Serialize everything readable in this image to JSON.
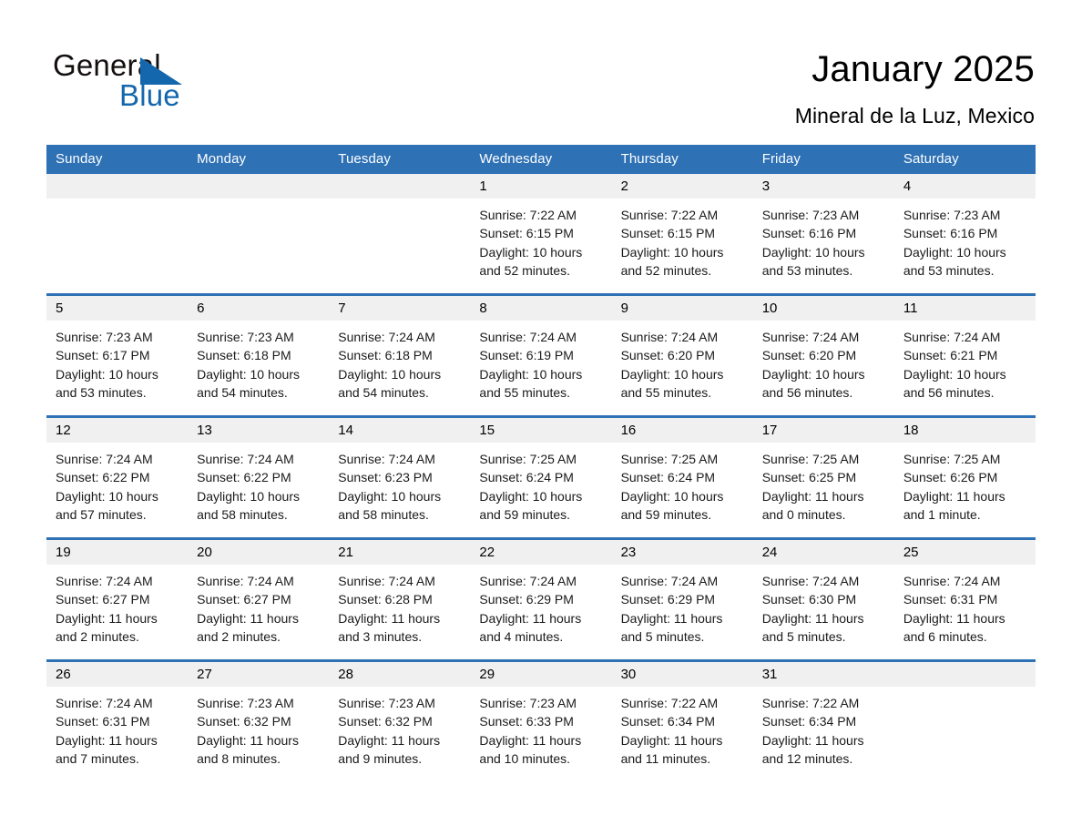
{
  "brand": {
    "word1": "General",
    "word2": "Blue",
    "triangle_color": "#1567ad"
  },
  "header": {
    "title": "January 2025",
    "subtitle": "Mineral de la Luz, Mexico"
  },
  "theme": {
    "header_blue": "#2e71b5",
    "daynum_band": "#f0f0f0",
    "text": "#000000"
  },
  "weekday_headers": [
    "Sunday",
    "Monday",
    "Tuesday",
    "Wednesday",
    "Thursday",
    "Friday",
    "Saturday"
  ],
  "weeks": [
    [
      {
        "day": "",
        "sunrise": "",
        "sunset": "",
        "daylight1": "",
        "daylight2": ""
      },
      {
        "day": "",
        "sunrise": "",
        "sunset": "",
        "daylight1": "",
        "daylight2": ""
      },
      {
        "day": "",
        "sunrise": "",
        "sunset": "",
        "daylight1": "",
        "daylight2": ""
      },
      {
        "day": "1",
        "sunrise": "Sunrise: 7:22 AM",
        "sunset": "Sunset: 6:15 PM",
        "daylight1": "Daylight: 10 hours",
        "daylight2": "and 52 minutes."
      },
      {
        "day": "2",
        "sunrise": "Sunrise: 7:22 AM",
        "sunset": "Sunset: 6:15 PM",
        "daylight1": "Daylight: 10 hours",
        "daylight2": "and 52 minutes."
      },
      {
        "day": "3",
        "sunrise": "Sunrise: 7:23 AM",
        "sunset": "Sunset: 6:16 PM",
        "daylight1": "Daylight: 10 hours",
        "daylight2": "and 53 minutes."
      },
      {
        "day": "4",
        "sunrise": "Sunrise: 7:23 AM",
        "sunset": "Sunset: 6:16 PM",
        "daylight1": "Daylight: 10 hours",
        "daylight2": "and 53 minutes."
      }
    ],
    [
      {
        "day": "5",
        "sunrise": "Sunrise: 7:23 AM",
        "sunset": "Sunset: 6:17 PM",
        "daylight1": "Daylight: 10 hours",
        "daylight2": "and 53 minutes."
      },
      {
        "day": "6",
        "sunrise": "Sunrise: 7:23 AM",
        "sunset": "Sunset: 6:18 PM",
        "daylight1": "Daylight: 10 hours",
        "daylight2": "and 54 minutes."
      },
      {
        "day": "7",
        "sunrise": "Sunrise: 7:24 AM",
        "sunset": "Sunset: 6:18 PM",
        "daylight1": "Daylight: 10 hours",
        "daylight2": "and 54 minutes."
      },
      {
        "day": "8",
        "sunrise": "Sunrise: 7:24 AM",
        "sunset": "Sunset: 6:19 PM",
        "daylight1": "Daylight: 10 hours",
        "daylight2": "and 55 minutes."
      },
      {
        "day": "9",
        "sunrise": "Sunrise: 7:24 AM",
        "sunset": "Sunset: 6:20 PM",
        "daylight1": "Daylight: 10 hours",
        "daylight2": "and 55 minutes."
      },
      {
        "day": "10",
        "sunrise": "Sunrise: 7:24 AM",
        "sunset": "Sunset: 6:20 PM",
        "daylight1": "Daylight: 10 hours",
        "daylight2": "and 56 minutes."
      },
      {
        "day": "11",
        "sunrise": "Sunrise: 7:24 AM",
        "sunset": "Sunset: 6:21 PM",
        "daylight1": "Daylight: 10 hours",
        "daylight2": "and 56 minutes."
      }
    ],
    [
      {
        "day": "12",
        "sunrise": "Sunrise: 7:24 AM",
        "sunset": "Sunset: 6:22 PM",
        "daylight1": "Daylight: 10 hours",
        "daylight2": "and 57 minutes."
      },
      {
        "day": "13",
        "sunrise": "Sunrise: 7:24 AM",
        "sunset": "Sunset: 6:22 PM",
        "daylight1": "Daylight: 10 hours",
        "daylight2": "and 58 minutes."
      },
      {
        "day": "14",
        "sunrise": "Sunrise: 7:24 AM",
        "sunset": "Sunset: 6:23 PM",
        "daylight1": "Daylight: 10 hours",
        "daylight2": "and 58 minutes."
      },
      {
        "day": "15",
        "sunrise": "Sunrise: 7:25 AM",
        "sunset": "Sunset: 6:24 PM",
        "daylight1": "Daylight: 10 hours",
        "daylight2": "and 59 minutes."
      },
      {
        "day": "16",
        "sunrise": "Sunrise: 7:25 AM",
        "sunset": "Sunset: 6:24 PM",
        "daylight1": "Daylight: 10 hours",
        "daylight2": "and 59 minutes."
      },
      {
        "day": "17",
        "sunrise": "Sunrise: 7:25 AM",
        "sunset": "Sunset: 6:25 PM",
        "daylight1": "Daylight: 11 hours",
        "daylight2": "and 0 minutes."
      },
      {
        "day": "18",
        "sunrise": "Sunrise: 7:25 AM",
        "sunset": "Sunset: 6:26 PM",
        "daylight1": "Daylight: 11 hours",
        "daylight2": "and 1 minute."
      }
    ],
    [
      {
        "day": "19",
        "sunrise": "Sunrise: 7:24 AM",
        "sunset": "Sunset: 6:27 PM",
        "daylight1": "Daylight: 11 hours",
        "daylight2": "and 2 minutes."
      },
      {
        "day": "20",
        "sunrise": "Sunrise: 7:24 AM",
        "sunset": "Sunset: 6:27 PM",
        "daylight1": "Daylight: 11 hours",
        "daylight2": "and 2 minutes."
      },
      {
        "day": "21",
        "sunrise": "Sunrise: 7:24 AM",
        "sunset": "Sunset: 6:28 PM",
        "daylight1": "Daylight: 11 hours",
        "daylight2": "and 3 minutes."
      },
      {
        "day": "22",
        "sunrise": "Sunrise: 7:24 AM",
        "sunset": "Sunset: 6:29 PM",
        "daylight1": "Daylight: 11 hours",
        "daylight2": "and 4 minutes."
      },
      {
        "day": "23",
        "sunrise": "Sunrise: 7:24 AM",
        "sunset": "Sunset: 6:29 PM",
        "daylight1": "Daylight: 11 hours",
        "daylight2": "and 5 minutes."
      },
      {
        "day": "24",
        "sunrise": "Sunrise: 7:24 AM",
        "sunset": "Sunset: 6:30 PM",
        "daylight1": "Daylight: 11 hours",
        "daylight2": "and 5 minutes."
      },
      {
        "day": "25",
        "sunrise": "Sunrise: 7:24 AM",
        "sunset": "Sunset: 6:31 PM",
        "daylight1": "Daylight: 11 hours",
        "daylight2": "and 6 minutes."
      }
    ],
    [
      {
        "day": "26",
        "sunrise": "Sunrise: 7:24 AM",
        "sunset": "Sunset: 6:31 PM",
        "daylight1": "Daylight: 11 hours",
        "daylight2": "and 7 minutes."
      },
      {
        "day": "27",
        "sunrise": "Sunrise: 7:23 AM",
        "sunset": "Sunset: 6:32 PM",
        "daylight1": "Daylight: 11 hours",
        "daylight2": "and 8 minutes."
      },
      {
        "day": "28",
        "sunrise": "Sunrise: 7:23 AM",
        "sunset": "Sunset: 6:32 PM",
        "daylight1": "Daylight: 11 hours",
        "daylight2": "and 9 minutes."
      },
      {
        "day": "29",
        "sunrise": "Sunrise: 7:23 AM",
        "sunset": "Sunset: 6:33 PM",
        "daylight1": "Daylight: 11 hours",
        "daylight2": "and 10 minutes."
      },
      {
        "day": "30",
        "sunrise": "Sunrise: 7:22 AM",
        "sunset": "Sunset: 6:34 PM",
        "daylight1": "Daylight: 11 hours",
        "daylight2": "and 11 minutes."
      },
      {
        "day": "31",
        "sunrise": "Sunrise: 7:22 AM",
        "sunset": "Sunset: 6:34 PM",
        "daylight1": "Daylight: 11 hours",
        "daylight2": "and 12 minutes."
      },
      {
        "day": "",
        "sunrise": "",
        "sunset": "",
        "daylight1": "",
        "daylight2": ""
      }
    ]
  ]
}
